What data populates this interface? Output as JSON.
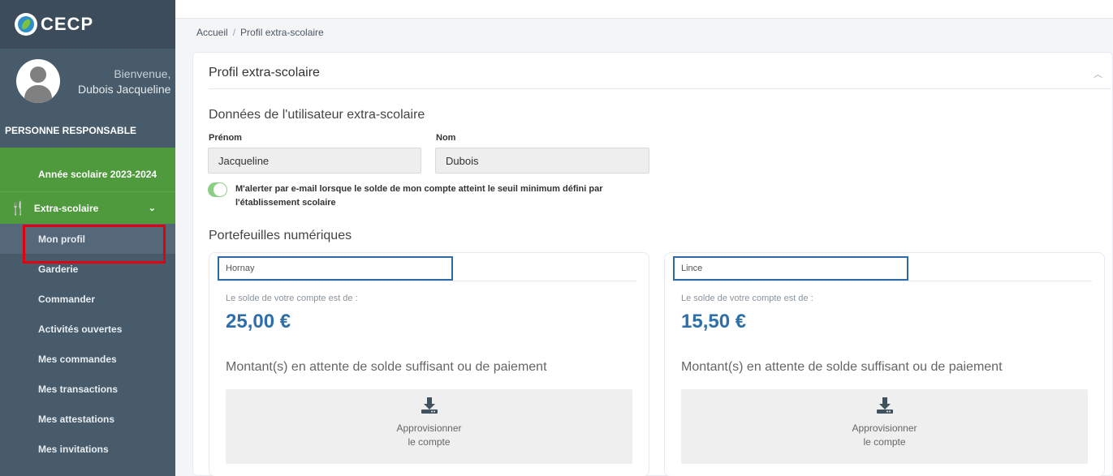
{
  "app": {
    "logo_text": "CECP"
  },
  "user": {
    "welcome": "Bienvenue,",
    "name": "Dubois Jacqueline",
    "role": "PERSONNE RESPONSABLE"
  },
  "sidebar": {
    "year": "Année scolaire 2023-2024",
    "section": "Extra-scolaire",
    "items": [
      {
        "label": "Mon profil"
      },
      {
        "label": "Garderie"
      },
      {
        "label": "Commander"
      },
      {
        "label": "Activités ouvertes"
      },
      {
        "label": "Mes commandes"
      },
      {
        "label": "Mes transactions"
      },
      {
        "label": "Mes attestations"
      },
      {
        "label": "Mes invitations"
      }
    ]
  },
  "breadcrumb": {
    "home": "Accueil",
    "sep": "/",
    "current": "Profil extra-scolaire"
  },
  "card": {
    "title": "Profil extra-scolaire",
    "user_section": "Données de l'utilisateur extra-scolaire",
    "firstname_label": "Prénom",
    "firstname_value": "Jacqueline",
    "lastname_label": "Nom",
    "lastname_value": "Dubois",
    "alert_text": "M'alerter par e-mail lorsque le solde de mon compte atteint le seuil minimum défini par l'établissement scolaire",
    "wallets_section": "Portefeuilles numériques"
  },
  "wallets": [
    {
      "name": "Hornay",
      "balance_label": "Le solde de votre compte est de :",
      "balance": "25,00 €",
      "pending": "Montant(s) en attente de solde suffisant ou de paiement",
      "topup_line1": "Approvisionner",
      "topup_line2": "le compte"
    },
    {
      "name": "Lince",
      "balance_label": "Le solde de votre compte est de :",
      "balance": "15,50 €",
      "pending": "Montant(s) en attente de solde suffisant ou de paiement",
      "topup_line1": "Approvisionner",
      "topup_line2": "le compte"
    }
  ],
  "colors": {
    "sidebar": "#485b6b",
    "accent_green": "#4f9a3d",
    "balance_blue": "#2e6fa9",
    "highlight_red": "#e3000f"
  }
}
